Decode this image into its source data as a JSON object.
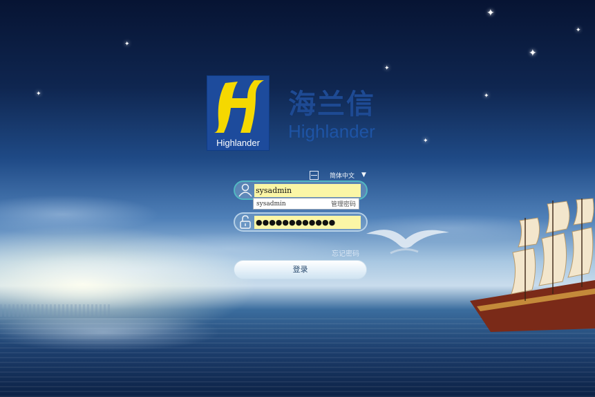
{
  "brand": {
    "logo_word": "Highlander",
    "name_cn": "海兰信",
    "name_en": "Highlander"
  },
  "language": {
    "icon": "language-grid-icon",
    "selected": "简体中文",
    "arrow": "▼"
  },
  "login": {
    "username_value": "sysadmin",
    "username_icon": "user-icon",
    "password_value": "●●●●●●●●●●●●",
    "password_icon": "lock-icon",
    "autocomplete_entry": "sysadmin",
    "autocomplete_manage": "管理密码",
    "forgot_password": "忘记密码",
    "login_button": "登录"
  },
  "colors": {
    "brand_blue": "#1d4b9c",
    "logo_yellow": "#f5d800",
    "field_fill": "#fbf6a6"
  }
}
